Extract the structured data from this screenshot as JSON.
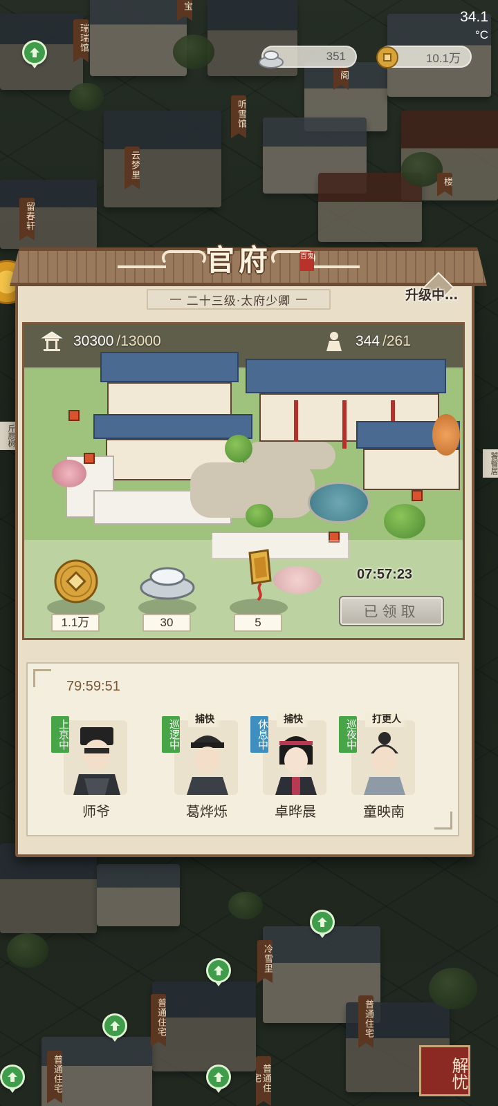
{
  "status_bar": {
    "temperature": "34.1",
    "temperature_unit": "°C"
  },
  "resources": {
    "silver": "351",
    "coins": "10.1万"
  },
  "map_labels": {
    "top": [
      "瑞瑞馆",
      "宝",
      "听雪馆",
      "云梦里",
      "留春轩",
      "阁",
      "楼"
    ],
    "bottom": [
      "冷雪里",
      "普通住宅",
      "普通住宅",
      "普通住宅",
      "普通住宅"
    ],
    "left_side": "斤愿树",
    "right_side": "饕餮居"
  },
  "panel": {
    "title": "官府",
    "seal_text": "百鬼",
    "rank": "二十三级·太府少卿",
    "upgrading": "升级中…",
    "stats": {
      "prosperity_current": "30300",
      "prosperity_target": "/13000",
      "population_current": "344",
      "population_target": "/261"
    },
    "rewards": [
      {
        "icon": "copper-coin-icon",
        "count": "1.1万"
      },
      {
        "icon": "silver-ingot-icon",
        "count": "30"
      },
      {
        "icon": "token-plaque-icon",
        "count": "5"
      }
    ],
    "reward_timer": "07:57:23",
    "claim_button": "已领取"
  },
  "staff": {
    "timer": "79:59:51",
    "members": [
      {
        "name": "师爷",
        "role": "",
        "status": "上京中",
        "status_color": "#47a548"
      },
      {
        "name": "葛烨烁",
        "role": "捕快",
        "status": "巡逻中",
        "status_color": "#47a548"
      },
      {
        "name": "卓晔晨",
        "role": "捕快",
        "status": "休息中",
        "status_color": "#3d8fbf"
      },
      {
        "name": "童映南",
        "role": "打更人",
        "status": "巡夜中",
        "status_color": "#47a548"
      }
    ]
  },
  "corner_button": "解忧"
}
